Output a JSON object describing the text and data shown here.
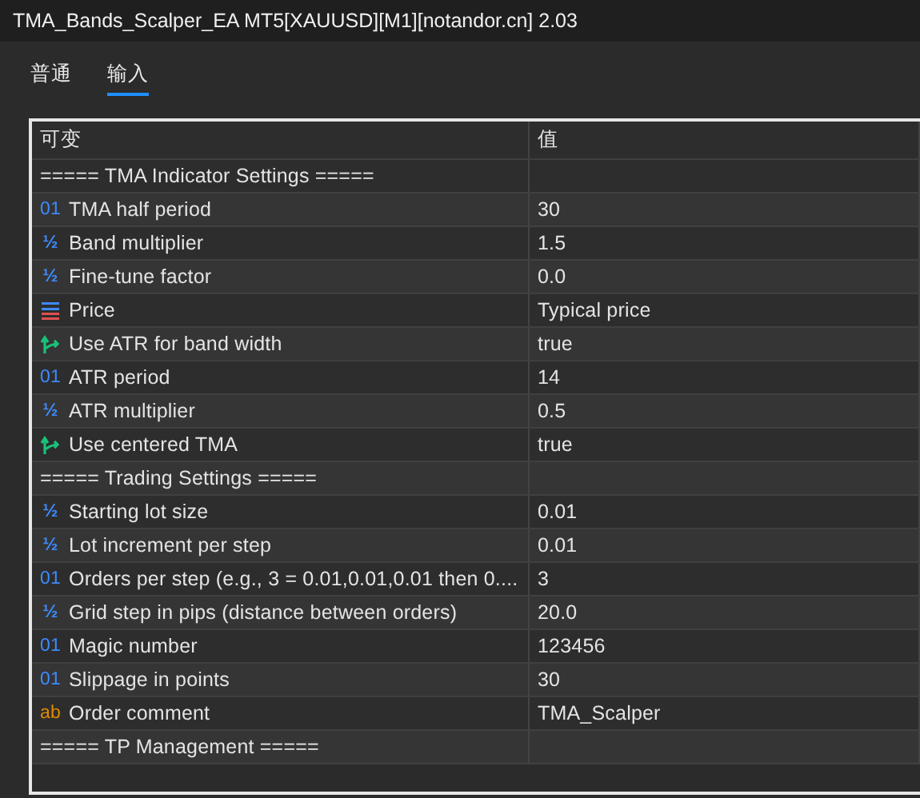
{
  "window": {
    "title": "TMA_Bands_Scalper_EA MT5[XAUUSD][M1][notandor.cn] 2.03"
  },
  "tabs": [
    {
      "label": "普通",
      "selected": false
    },
    {
      "label": "输入",
      "selected": true
    }
  ],
  "table": {
    "columns": [
      "可变",
      "值"
    ],
    "rows": [
      {
        "kind": "separator",
        "name": "===== TMA Indicator Settings =====",
        "value": ""
      },
      {
        "kind": "int",
        "glyph": "01",
        "name": "TMA half period",
        "value": "30"
      },
      {
        "kind": "double",
        "glyph": "½",
        "name": "Band multiplier",
        "value": "1.5"
      },
      {
        "kind": "double",
        "glyph": "½",
        "name": "Fine-tune factor",
        "value": "0.0"
      },
      {
        "kind": "enum",
        "name": "Price",
        "value": "Typical price"
      },
      {
        "kind": "bool",
        "name": "Use ATR for band width",
        "value": "true"
      },
      {
        "kind": "int",
        "glyph": "01",
        "name": "ATR period",
        "value": "14"
      },
      {
        "kind": "double",
        "glyph": "½",
        "name": "ATR multiplier",
        "value": "0.5"
      },
      {
        "kind": "bool",
        "name": "Use centered TMA",
        "value": "true"
      },
      {
        "kind": "separator",
        "name": "===== Trading Settings =====",
        "value": ""
      },
      {
        "kind": "double",
        "glyph": "½",
        "name": "Starting lot size",
        "value": "0.01"
      },
      {
        "kind": "double",
        "glyph": "½",
        "name": "Lot increment per step",
        "value": "0.01"
      },
      {
        "kind": "int",
        "glyph": "01",
        "name": "Orders per step (e.g., 3 = 0.01,0.01,0.01 then 0....",
        "value": "3"
      },
      {
        "kind": "double",
        "glyph": "½",
        "name": "Grid step in pips (distance between orders)",
        "value": "20.0"
      },
      {
        "kind": "int",
        "glyph": "01",
        "name": "Magic number",
        "value": "123456"
      },
      {
        "kind": "int",
        "glyph": "01",
        "name": "Slippage in points",
        "value": "30"
      },
      {
        "kind": "string",
        "glyph": "ab",
        "name": "Order comment",
        "value": "TMA_Scalper"
      },
      {
        "kind": "separator",
        "name": "===== TP Management =====",
        "value": ""
      }
    ]
  }
}
